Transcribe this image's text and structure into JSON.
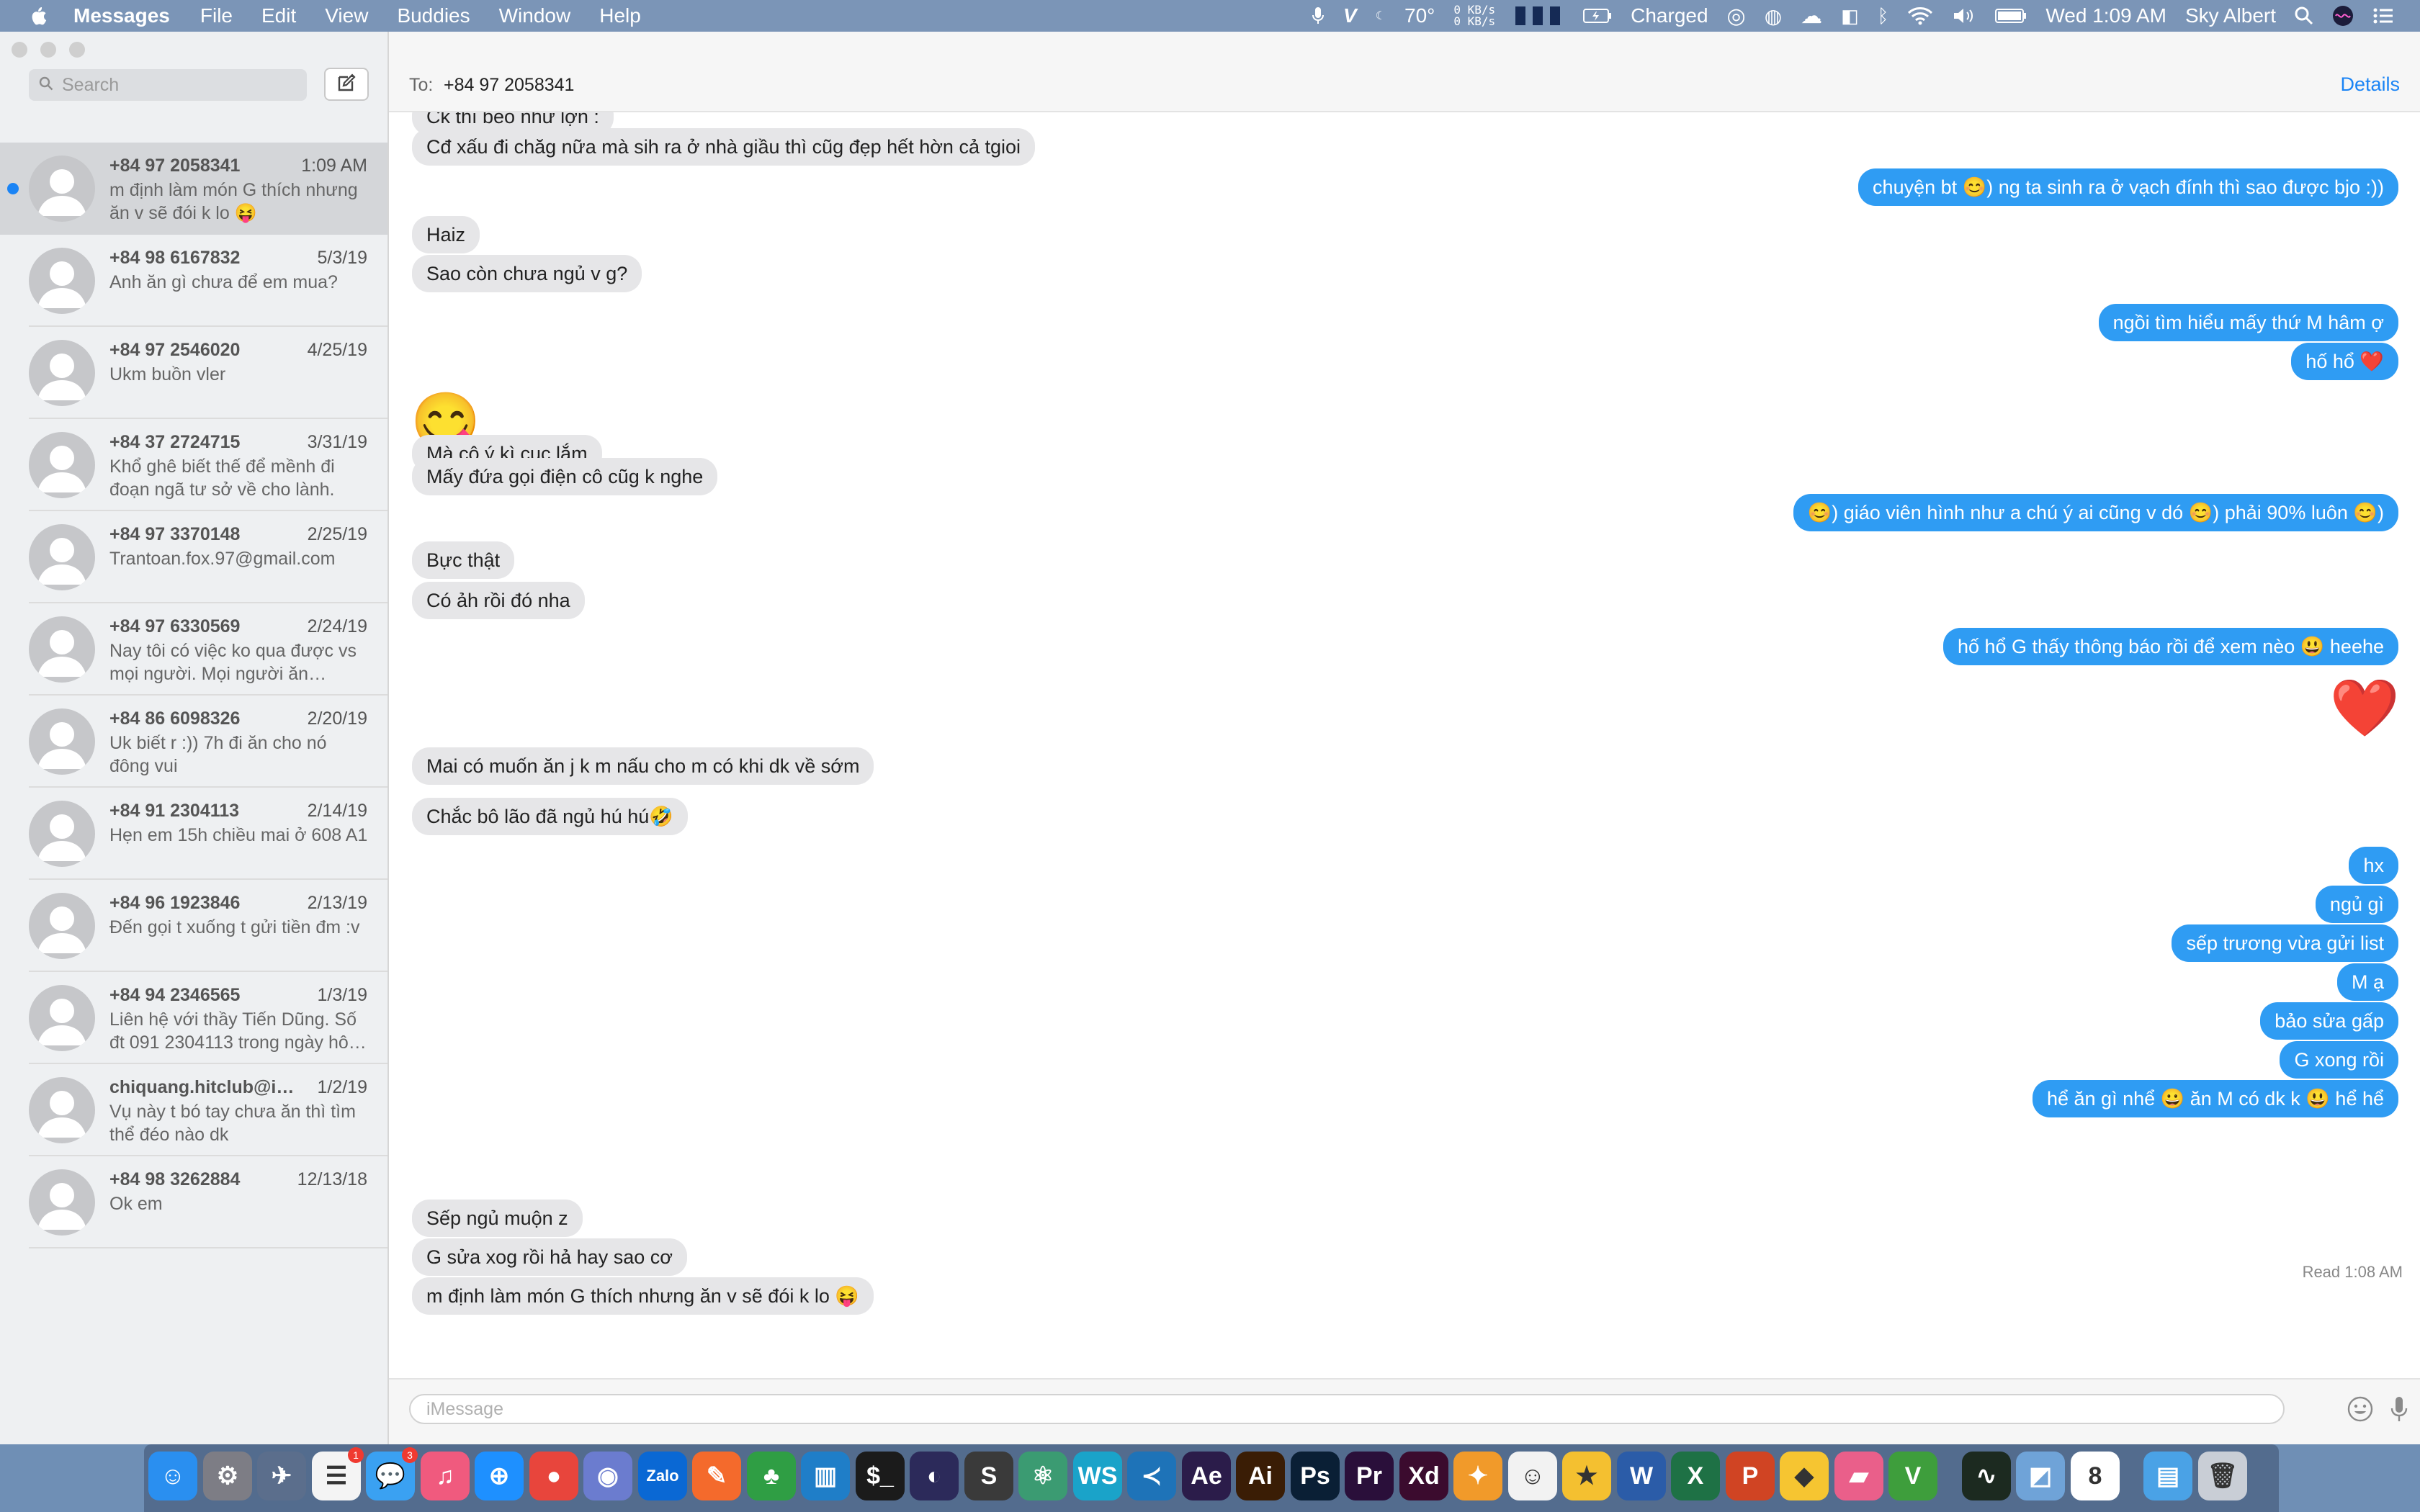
{
  "menubar": {
    "app": "Messages",
    "items": [
      "File",
      "Edit",
      "View",
      "Buddies",
      "Window",
      "Help"
    ],
    "temperature": "70°",
    "net_up": "0 KB/s",
    "net_down": "0 KB/s",
    "battery_status": "Charged",
    "clock": "Wed 1:09 AM",
    "user": "Sky Albert"
  },
  "sidebar": {
    "search_placeholder": "Search",
    "conversations": [
      {
        "name": "+84 97 2058341",
        "date": "1:09 AM",
        "preview": "m định làm món G thích nhưng ăn v sẽ đói k lo 😝",
        "selected": true,
        "unread": true
      },
      {
        "name": "+84 98 6167832",
        "date": "5/3/19",
        "preview": "Anh ăn gì chưa để em mua?"
      },
      {
        "name": "+84 97 2546020",
        "date": "4/25/19",
        "preview": "Ukm buồn vler"
      },
      {
        "name": "+84 37 2724715",
        "date": "3/31/19",
        "preview": "Khổ ghê biết thế để mềnh đi đoạn ngã tư sở về cho lành."
      },
      {
        "name": "+84 97 3370148",
        "date": "2/25/19",
        "preview": "Trantoan.fox.97@gmail.com"
      },
      {
        "name": "+84 97 6330569",
        "date": "2/24/19",
        "preview": "Nay tôi có việc ko qua được vs mọi người. Mọi người ăn ngon…"
      },
      {
        "name": "+84 86 6098326",
        "date": "2/20/19",
        "preview": "Uk biết r :)) 7h đi ăn cho nó đông vui"
      },
      {
        "name": "+84 91 2304113",
        "date": "2/14/19",
        "preview": "Hẹn em 15h chiều mai ở 608 A1"
      },
      {
        "name": "+84 96 1923846",
        "date": "2/13/19",
        "preview": "Đến gọi t xuống t gửi tiền đm :v"
      },
      {
        "name": "+84 94 2346565",
        "date": "1/3/19",
        "preview": "Liên hệ với thầy Tiến Dũng. Số đt 091 2304113 trong ngày hô…"
      },
      {
        "name": "chiquang.hitclub@icl...",
        "date": "1/2/19",
        "preview": "Vụ này t bó tay chưa ăn thì tìm thể đéo nào dk"
      },
      {
        "name": "+84 98 3262884",
        "date": "12/13/18",
        "preview": "Ok em"
      }
    ]
  },
  "header": {
    "to_label": "To:",
    "to_value": "+84 97 2058341",
    "details": "Details"
  },
  "messages": [
    {
      "dir": "in",
      "text": "Ck thì béo như lợn :"
    },
    {
      "dir": "in",
      "text": "Cđ xấu đi chăg nữa mà sih ra ở nhà giầu thì cũg đẹp hết hờn cả tgioi"
    },
    {
      "dir": "out",
      "text": "chuyện bt 😊) ng ta sinh ra ở vạch đính thì sao được bjo :))"
    },
    {
      "dir": "in",
      "text": "Haiz"
    },
    {
      "dir": "in",
      "text": "Sao còn chưa ngủ v g?"
    },
    {
      "dir": "out",
      "text": "ngồi tìm hiểu mấy thứ M hâm ợ"
    },
    {
      "dir": "out",
      "text": "hố hổ ❤️"
    },
    {
      "dir": "in",
      "text": "😋",
      "big": true
    },
    {
      "dir": "in",
      "text": "Mà cô ý kì cục lắm"
    },
    {
      "dir": "in",
      "text": "Mấy đứa gọi điện cô cũg k nghe"
    },
    {
      "dir": "out",
      "text": "😊) giáo viên hình như a chú ý ai cũng v dó 😊) phải 90% luôn 😊)"
    },
    {
      "dir": "in",
      "text": "Bực thật"
    },
    {
      "dir": "in",
      "text": "Có ảh rồi đó nha"
    },
    {
      "dir": "out",
      "text": "hố hổ G thấy thông báo rồi để xem nèo 😃 heehe"
    },
    {
      "dir": "out",
      "text": "❤️",
      "big": true
    },
    {
      "dir": "in",
      "text": "Mai có muốn ăn j k m nấu cho m có khi dk về sớm"
    },
    {
      "dir": "in",
      "text": "Chắc bô lão đã ngủ hú hú🤣"
    },
    {
      "dir": "out",
      "text": "hx"
    },
    {
      "dir": "out",
      "text": "ngủ gì"
    },
    {
      "dir": "out",
      "text": "sếp trương vừa gửi list"
    },
    {
      "dir": "out",
      "text": "M ạ"
    },
    {
      "dir": "out",
      "text": "bảo sửa gấp"
    },
    {
      "dir": "out",
      "text": "G xong rồi"
    },
    {
      "dir": "out",
      "text": "hể ăn gì nhể 😀 ăn M có dk k 😃 hể hể"
    },
    {
      "dir": "in",
      "text": "Sếp ngủ muộn z"
    },
    {
      "dir": "in",
      "text": "G sửa xog rồi hả hay sao cơ"
    },
    {
      "dir": "in",
      "text": "m định làm món G thích nhưng ăn v sẽ đói k lo 😝"
    }
  ],
  "read_receipt": "Read 1:08 AM",
  "composer": {
    "placeholder": "iMessage"
  },
  "dock": {
    "apps": [
      {
        "name": "Finder",
        "color": "#2a8ff0",
        "glyph": "☺"
      },
      {
        "name": "System Preferences",
        "color": "#7d7d85",
        "glyph": "⚙"
      },
      {
        "name": "Launchpad",
        "color": "#5b6e8c",
        "glyph": "✈"
      },
      {
        "name": "Reminders",
        "color": "#f4f4f4",
        "glyph": "☰",
        "badge": "1"
      },
      {
        "name": "Messages",
        "color": "#3aa1f2",
        "glyph": "💬",
        "badge": "3"
      },
      {
        "name": "iTunes",
        "color": "#f05a7e",
        "glyph": "♫"
      },
      {
        "name": "Safari",
        "color": "#1e90ff",
        "glyph": "⊕"
      },
      {
        "name": "Chrome",
        "color": "#e8453c",
        "glyph": "●"
      },
      {
        "name": "Discord",
        "color": "#6b7ccf",
        "glyph": "◉"
      },
      {
        "name": "Zalo",
        "color": "#0a68d4",
        "glyph": "Zalo"
      },
      {
        "name": "Sketch",
        "color": "#f46a2c",
        "glyph": "✎"
      },
      {
        "name": "MongoDB",
        "color": "#2f9e44",
        "glyph": "♣"
      },
      {
        "name": "Trello",
        "color": "#1f7ec8",
        "glyph": "▥"
      },
      {
        "name": "Terminal",
        "color": "#1b1b1b",
        "glyph": "$_"
      },
      {
        "name": "Eclipse",
        "color": "#2c2a5a",
        "glyph": "◐"
      },
      {
        "name": "Sublime Text",
        "color": "#3a3a3a",
        "glyph": "S"
      },
      {
        "name": "Atom",
        "color": "#3b9b72",
        "glyph": "⚛"
      },
      {
        "name": "WebStorm",
        "color": "#1aa3c9",
        "glyph": "WS"
      },
      {
        "name": "VS Code",
        "color": "#1e73b8",
        "glyph": "≺"
      },
      {
        "name": "After Effects",
        "color": "#2b1c4a",
        "glyph": "Ae"
      },
      {
        "name": "Illustrator",
        "color": "#3a1d05",
        "glyph": "Ai"
      },
      {
        "name": "Photoshop",
        "color": "#0a1f35",
        "glyph": "Ps"
      },
      {
        "name": "Premiere",
        "color": "#2a0f3a",
        "glyph": "Pr"
      },
      {
        "name": "Adobe XD",
        "color": "#3b0b2e",
        "glyph": "Xd"
      },
      {
        "name": "Paw",
        "color": "#f19a2a",
        "glyph": "✦"
      },
      {
        "name": "Dr. Cleaner",
        "color": "#f2f2f2",
        "glyph": "☺"
      },
      {
        "name": "Reeder",
        "color": "#f4c030",
        "glyph": "★"
      },
      {
        "name": "Word",
        "color": "#2b5ca8",
        "glyph": "W"
      },
      {
        "name": "Excel",
        "color": "#1e7145",
        "glyph": "X"
      },
      {
        "name": "PowerPoint",
        "color": "#d04423",
        "glyph": "P"
      },
      {
        "name": "Cyberduck",
        "color": "#f6c531",
        "glyph": "◆"
      },
      {
        "name": "Folder Colorizer",
        "color": "#ea5f8a",
        "glyph": "▰"
      },
      {
        "name": "Vim",
        "color": "#3e9e3c",
        "glyph": "V"
      },
      {
        "name": "Activity Monitor",
        "color": "#1c2a20",
        "glyph": "∿"
      },
      {
        "name": "Preview",
        "color": "#6fa3d8",
        "glyph": "◩"
      },
      {
        "name": "Calendar",
        "color": "#ffffff",
        "glyph": "8"
      },
      {
        "name": "Downloads",
        "color": "#4aa2e6",
        "glyph": "▤"
      },
      {
        "name": "Trash",
        "color": "#c9ced6",
        "glyph": "🗑"
      }
    ]
  }
}
